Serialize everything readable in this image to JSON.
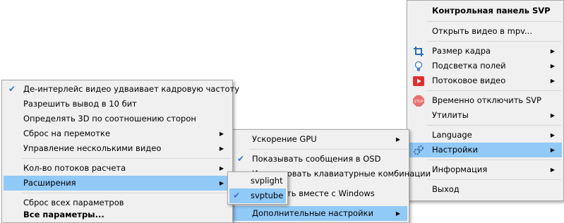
{
  "main_menu": {
    "title": "Контрольная панель SVP",
    "items": [
      {
        "label": "Открыть видео в mpv...",
        "icon": "",
        "submenu": false
      },
      {
        "label": "Размер кадра",
        "icon": "crop-icon",
        "submenu": true
      },
      {
        "label": "Подсветка полей",
        "icon": "lightbulb-icon",
        "submenu": true
      },
      {
        "label": "Потоковое видео",
        "icon": "play-red-icon",
        "submenu": true
      },
      {
        "label": "Временно отключить SVP",
        "icon": "stop-sign-icon",
        "submenu": false
      },
      {
        "label": "Утилиты",
        "icon": "",
        "submenu": true
      },
      {
        "label": "Language",
        "icon": "",
        "submenu": true
      },
      {
        "label": "Настройки",
        "icon": "gears-icon",
        "submenu": true
      },
      {
        "label": "Информация",
        "icon": "",
        "submenu": true
      },
      {
        "label": "Выход",
        "icon": "",
        "submenu": false
      }
    ]
  },
  "settings_menu": {
    "items": [
      {
        "label": "Ускорение GPU",
        "submenu": true
      },
      {
        "label": "Показывать сообщения в OSD",
        "checked": true
      },
      {
        "label": "Использовать клавиатурные комбинации",
        "checked": false
      },
      {
        "label": "Запускать вместе с Windows",
        "checked": false
      },
      {
        "label": "Дополнительные настройки",
        "submenu": true
      }
    ]
  },
  "advanced_menu": {
    "items": [
      {
        "label": "Де-интерлейс видео удваивает кадровую частоту",
        "checked": true
      },
      {
        "label": "Разрешить вывод в 10 бит",
        "checked": false
      },
      {
        "label": "Определять 3D по соотношению сторон",
        "checked": false
      },
      {
        "label": "Сброс на перемотке",
        "submenu": true
      },
      {
        "label": "Управление несколькими видео",
        "submenu": true
      },
      {
        "label": "Кол-во потоков расчета",
        "submenu": true
      },
      {
        "label": "Расширения",
        "submenu": true
      },
      {
        "label": "Сброс всех параметров",
        "submenu": false
      },
      {
        "label": "Все параметры...",
        "submenu": false,
        "bold": true
      }
    ]
  },
  "extensions_menu": {
    "items": [
      {
        "label": "svplight",
        "checked": false
      },
      {
        "label": "svptube",
        "checked": true
      }
    ]
  },
  "colors": {
    "highlight": "#91c9f7",
    "menu_bg": "#f0f0f0",
    "check": "#3a6fd8"
  }
}
